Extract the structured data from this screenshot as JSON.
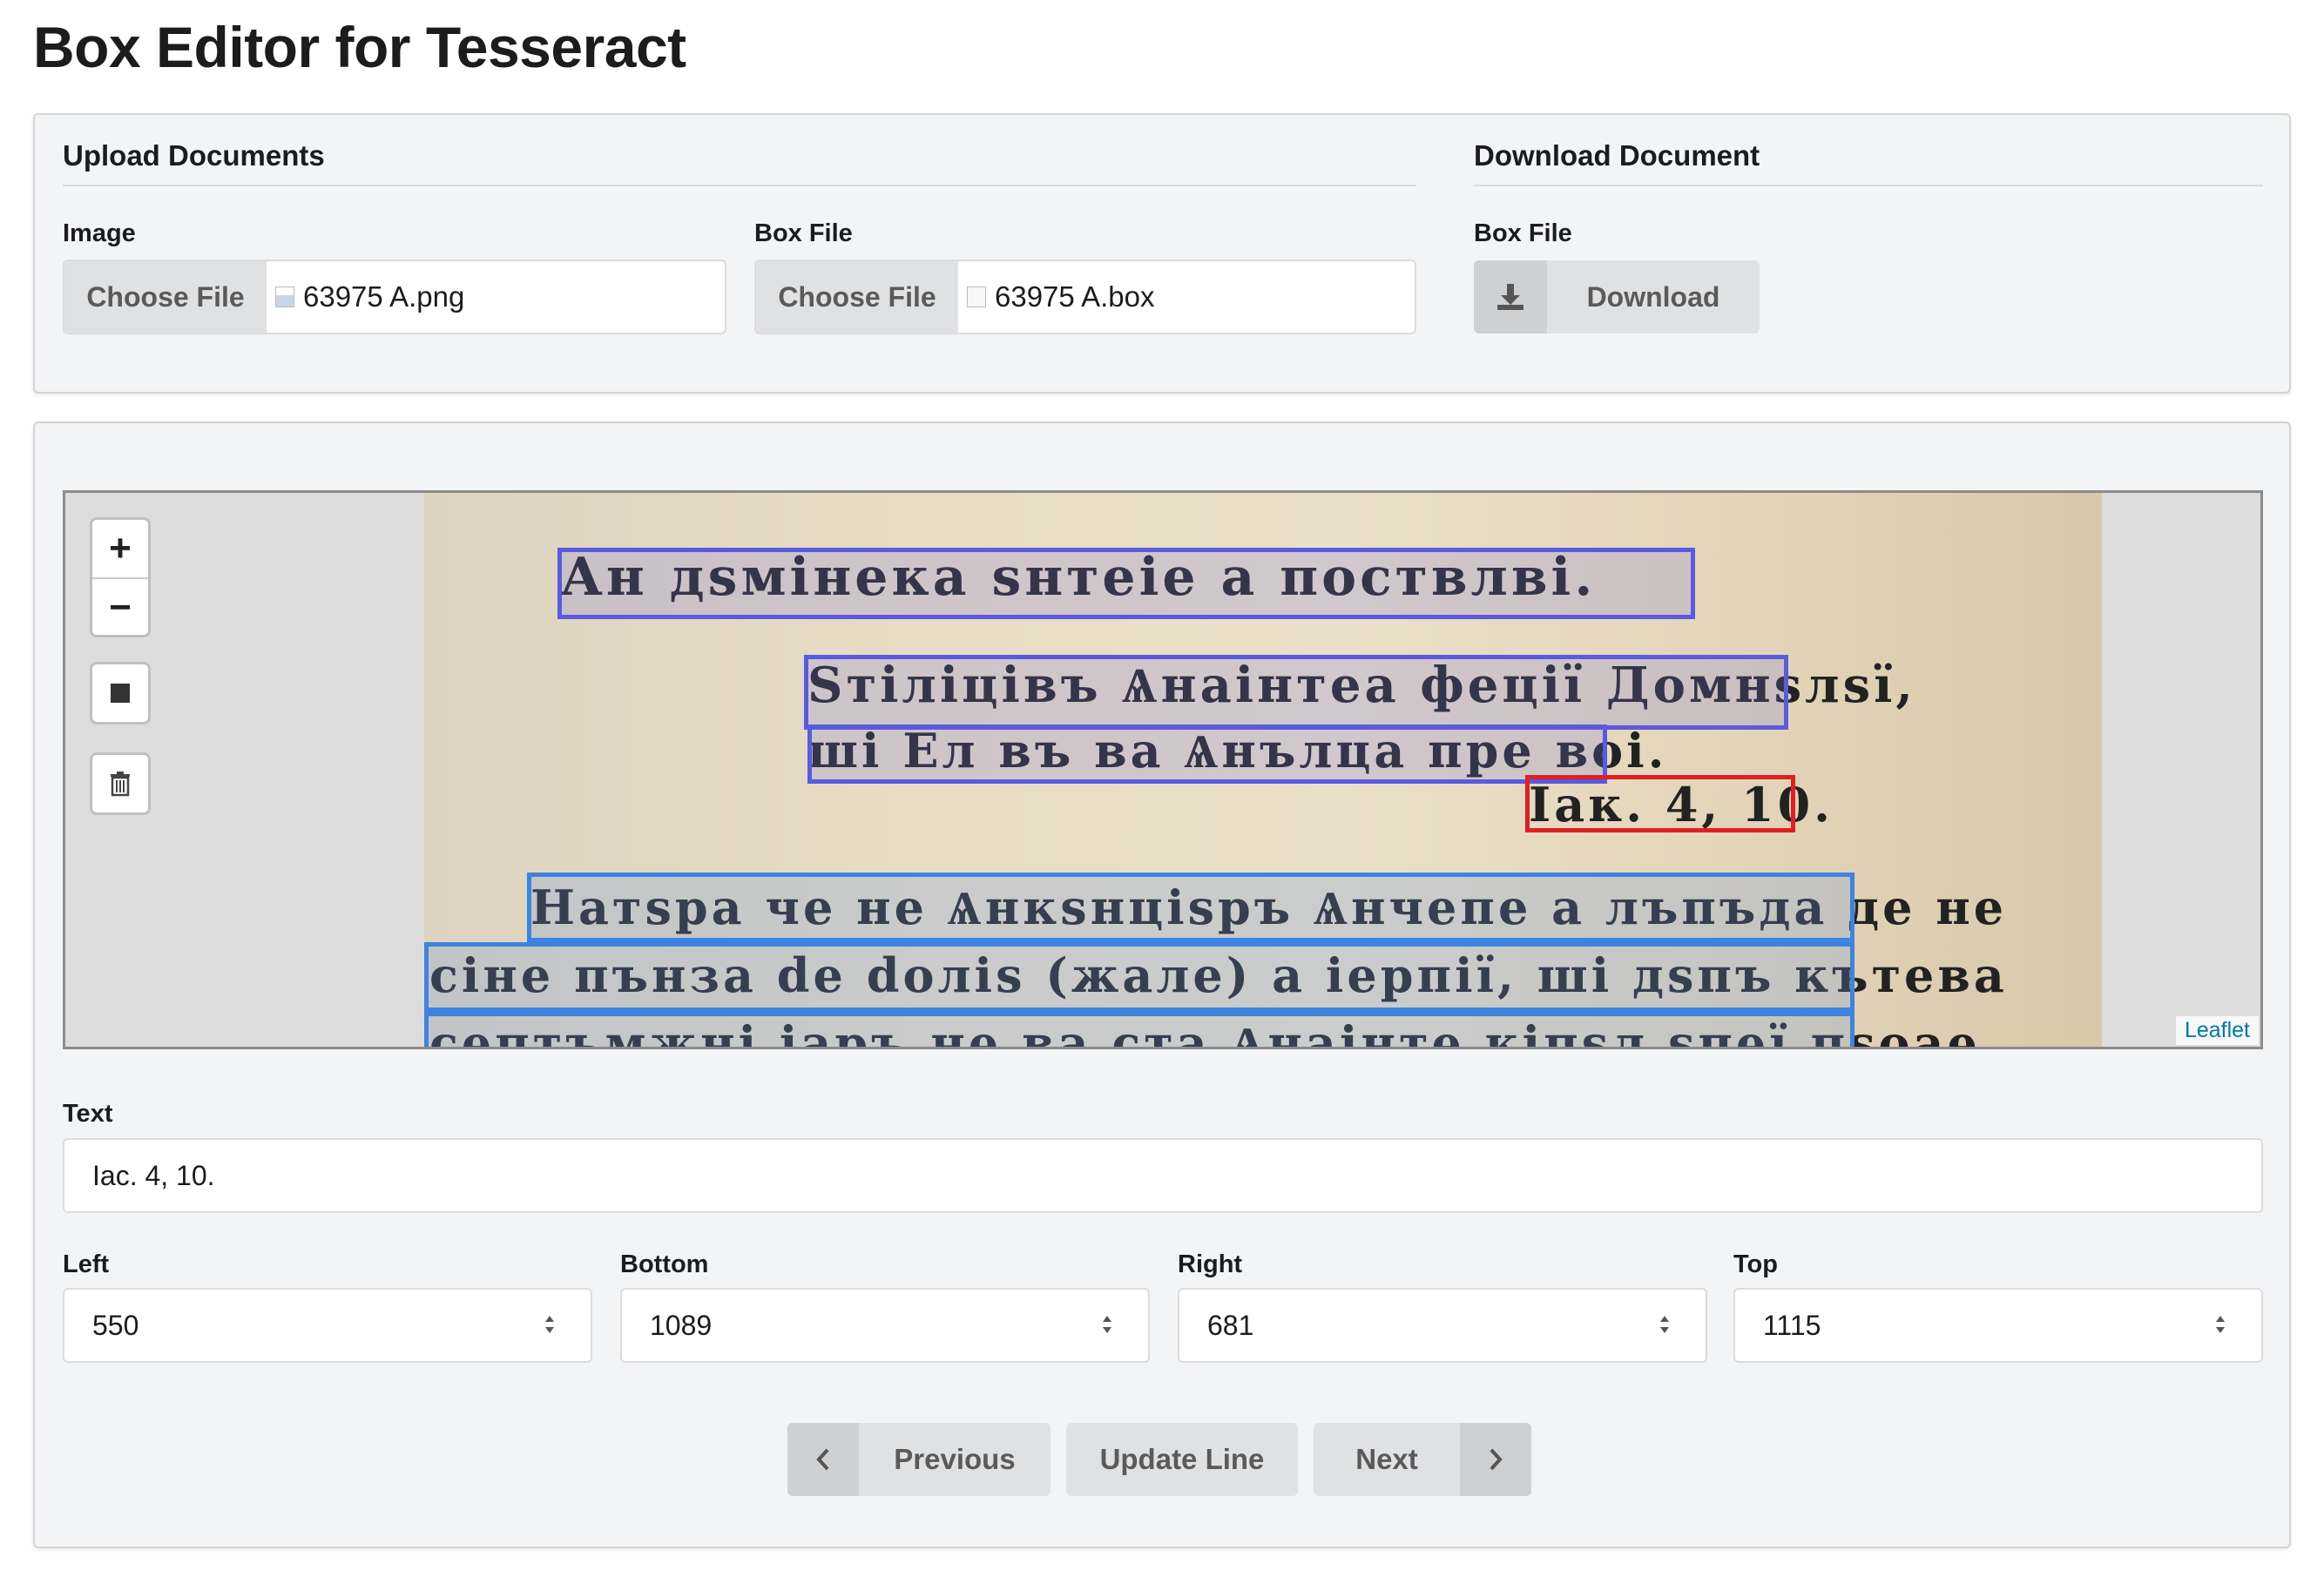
{
  "app": {
    "title": "Box Editor for Tesseract"
  },
  "upload": {
    "heading": "Upload Documents",
    "image": {
      "label": "Image",
      "button": "Choose File",
      "filename": "63975 A.png"
    },
    "box": {
      "label": "Box File",
      "button": "Choose File",
      "filename": "63975 A.box"
    }
  },
  "download": {
    "heading": "Download Document",
    "label": "Box File",
    "button": "Download",
    "icon": "download-icon"
  },
  "map": {
    "zoom_in": "+",
    "zoom_out": "−",
    "attribution": "Leaflet",
    "lines": [
      "Ан дѕмінека ѕнтеіе а поствлві.",
      "Ѕтіліцівъ Ѧнаінтеа феції Домнѕлѕї,",
      "ші Ел въ ва Ѧнълца пре воі.",
      "Іак. 4, 10.",
      "Натѕра че не Ѧнкѕнціѕръ Ѧнчепе а лъпъда де не",
      "сіне пънза de doліѕ (жале) а іерпії, ші дѕпъ кътева",
      "септъмжні іаръ не ва ста Ѧнаінте кіпѕл ѕпеї пѕоае"
    ]
  },
  "editor": {
    "text_label": "Text",
    "text_value": "Iac. 4, 10.",
    "left_label": "Left",
    "left_value": "550",
    "bottom_label": "Bottom",
    "bottom_value": "1089",
    "right_label": "Right",
    "right_value": "681",
    "top_label": "Top",
    "top_value": "1115"
  },
  "nav": {
    "previous": "Previous",
    "update": "Update Line",
    "next": "Next"
  }
}
